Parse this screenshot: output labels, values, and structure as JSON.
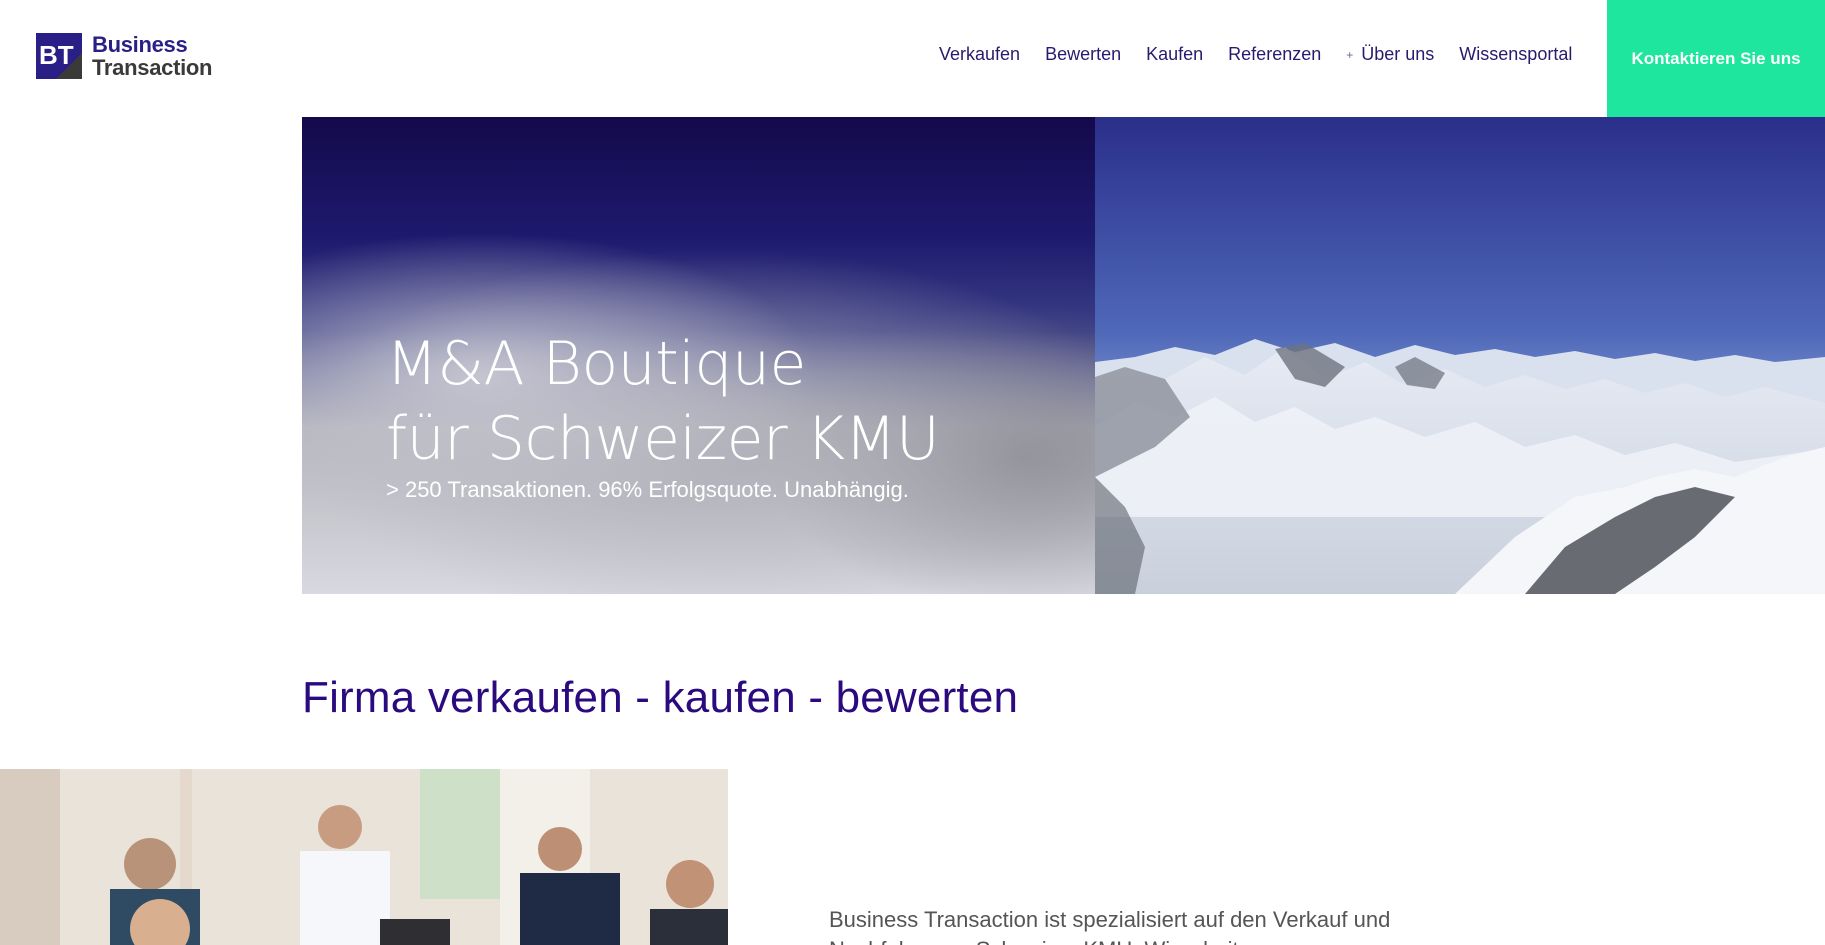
{
  "header": {
    "logo": {
      "mark": "BT",
      "line1": "Business",
      "line2": "Transaction"
    },
    "nav": [
      {
        "label": "Verkaufen"
      },
      {
        "label": "Bewerten"
      },
      {
        "label": "Kaufen"
      },
      {
        "label": "Referenzen"
      },
      {
        "label": "Über uns",
        "icon": "plus-icon"
      },
      {
        "label": "Wissensportal"
      }
    ],
    "cta": "Kontaktieren Sie uns"
  },
  "hero": {
    "title_line1": "M&A Boutique",
    "title_line2": "für Schweizer KMU",
    "subtitle": "> 250 Transaktionen. 96% Erfolgsquote. Unabhängig."
  },
  "section": {
    "title": "Firma verkaufen - kaufen - bewerten",
    "intro": "Business Transaction ist spezialisiert auf den Verkauf und Nachfolge von Schweizer KMU. Wir arbeiten"
  },
  "colors": {
    "brand": "#2a1f86",
    "accent": "#1ee69f",
    "heading": "#2a0a7e"
  }
}
